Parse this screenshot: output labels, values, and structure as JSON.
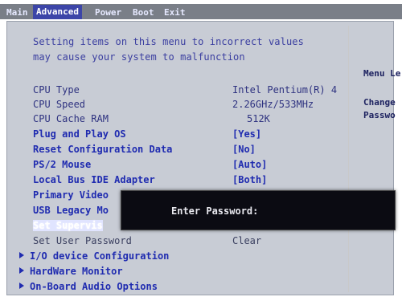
{
  "menu": [
    "Main",
    "Advanced",
    "Power",
    "Boot",
    "Exit"
  ],
  "warning": {
    "line1": "Setting items on this menu to incorrect values",
    "line2": "may cause your system to malfunction"
  },
  "items": [
    {
      "label": "CPU Type",
      "value": "Intel Pentium(R) 4"
    },
    {
      "label": "CPU Speed",
      "value": "2.26GHz/533MHz"
    },
    {
      "label": "CPU Cache RAM",
      "value": "512K"
    },
    {
      "label": "Plug and Play OS",
      "value": "[Yes]"
    },
    {
      "label": "Reset Configuration Data",
      "value": "[No]"
    },
    {
      "label": "PS/2 Mouse",
      "value": "[Auto]"
    },
    {
      "label": "Local Bus IDE Adapter",
      "value": "[Both]"
    },
    {
      "label": "Primary Video",
      "value": ""
    },
    {
      "label": "USB Legacy Mo",
      "value": ""
    },
    {
      "label": "Set Supervis",
      "value": ""
    },
    {
      "label": "Set User Password",
      "value": "Clear"
    }
  ],
  "submenus": [
    "I/O device Configuration",
    "HardWare Monitor",
    "On-Board Audio Options"
  ],
  "help": {
    "title": "Menu Le",
    "line1": "Change",
    "line2": "Passwo"
  },
  "dialog": {
    "label": "Enter Password:"
  },
  "colors": {
    "menubar": "#7a7f88",
    "menu_active": "#3c45a8",
    "panel": "#c8ccd5",
    "text_info": "#2e3280",
    "text_link": "#1f2bb0",
    "dialog_bg": "#0b0b12"
  }
}
